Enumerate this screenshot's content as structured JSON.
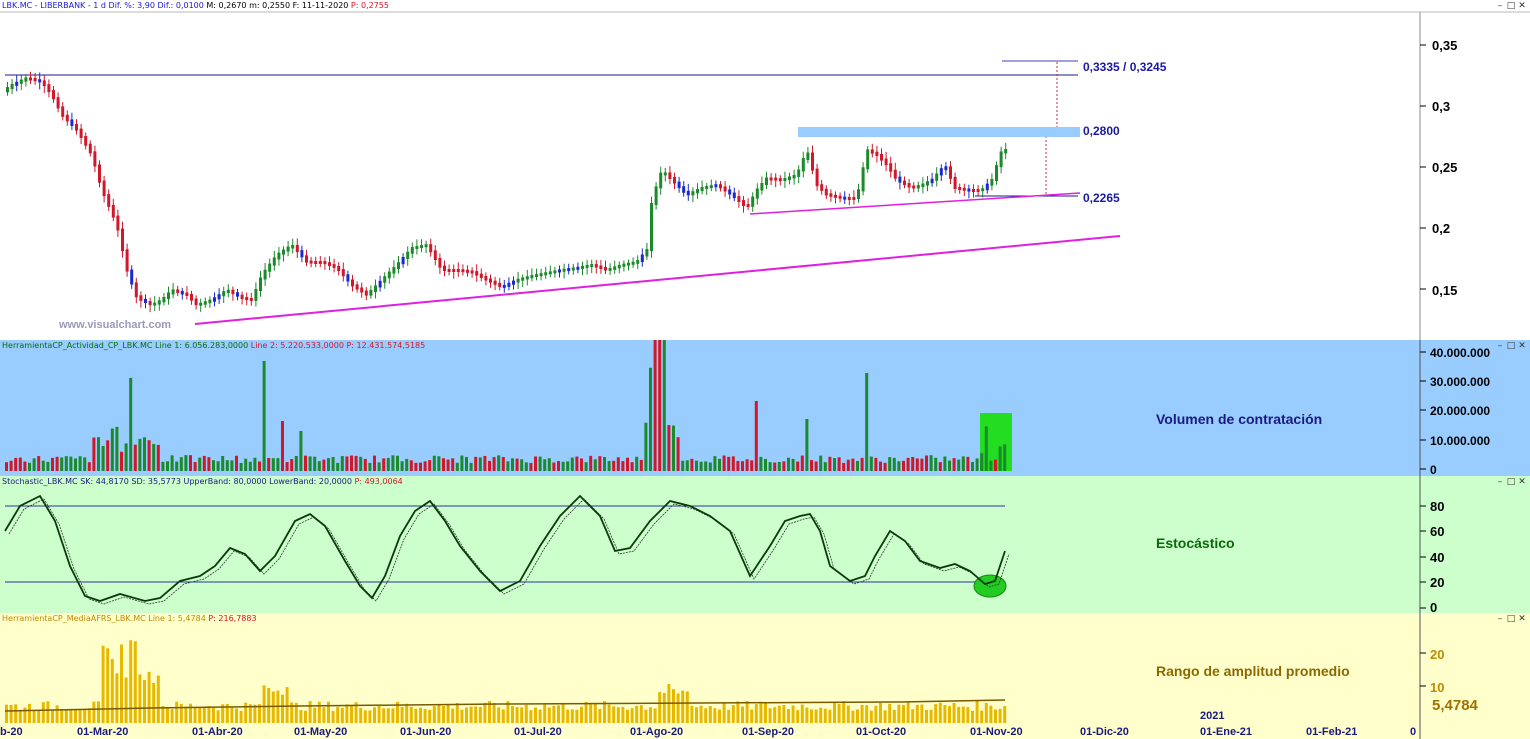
{
  "main": {
    "header": {
      "symbol": "LBK.MC - LIBERBANK",
      "interval": "-  1 d",
      "dif_pct": "Dif. %: 3,90",
      "dif": "Dif.: 0,0100",
      "m1": "M: 0,2670",
      "m2": "m: 0,2550",
      "date": "F: 11-11-2020",
      "price": "P: 0,2755"
    },
    "watermark": "www.visualchart.com",
    "yticks": [
      "0,35",
      "0,3",
      "0,25",
      "0,2",
      "0,15"
    ],
    "annotations": {
      "target": "0,3335 / 0,3245",
      "resistance": "0,2800",
      "support": "0,2265"
    }
  },
  "volume": {
    "header": {
      "name": "HerramientaCP_Actividad_CP_LBK.MC",
      "line1": "Line 1: 6.056.283,0000",
      "line2": "Line 2: 5.220.533,0000",
      "price": "P: 12.431.574,5185"
    },
    "label": "Volumen de contratación",
    "yticks": [
      "40.000.000",
      "30.000.000",
      "20.000.000",
      "10.000.000",
      "0"
    ]
  },
  "stochastic": {
    "header": {
      "name": "Stochastic_LBK.MC",
      "sk": "SK: 44,8170",
      "sd": "SD: 35,5773",
      "upper": "UpperBand: 80,0000",
      "lower": "LowerBand: 20,0000",
      "price": "P: 493,0064"
    },
    "label": "Estocástico",
    "yticks": [
      "80",
      "60",
      "40",
      "20",
      "0"
    ]
  },
  "atr": {
    "header": {
      "name": "HerramientaCP_MediaAFRS_LBK.MC",
      "line1": "Line 1: 5,4784",
      "price": "P: 216,7883"
    },
    "label": "Rango de amplitud promedio",
    "yticks": [
      "20",
      "10"
    ],
    "value": "5,4784"
  },
  "xaxis": {
    "labels": [
      "b-20",
      "01-Mar-20",
      "01-Abr-20",
      "01-May-20",
      "01-Jun-20",
      "01-Jul-20",
      "01-Ago-20",
      "01-Sep-20",
      "01-Oct-20",
      "01-Nov-20",
      "01-Dic-20",
      "01-Ene-21",
      "01-Feb-21",
      "0"
    ],
    "year": "2021"
  },
  "window_controls": {
    "minimize": "–",
    "restore": "□",
    "close": "✕"
  },
  "colors": {
    "up": "#1a8a2a",
    "down": "#d0182a",
    "blue_candle": "#1a2ad0",
    "volume_bg": "#99ccff",
    "stoch_bg": "#ccffcc",
    "atr_bg": "#ffffcc",
    "magenta": "#e020e0"
  }
}
